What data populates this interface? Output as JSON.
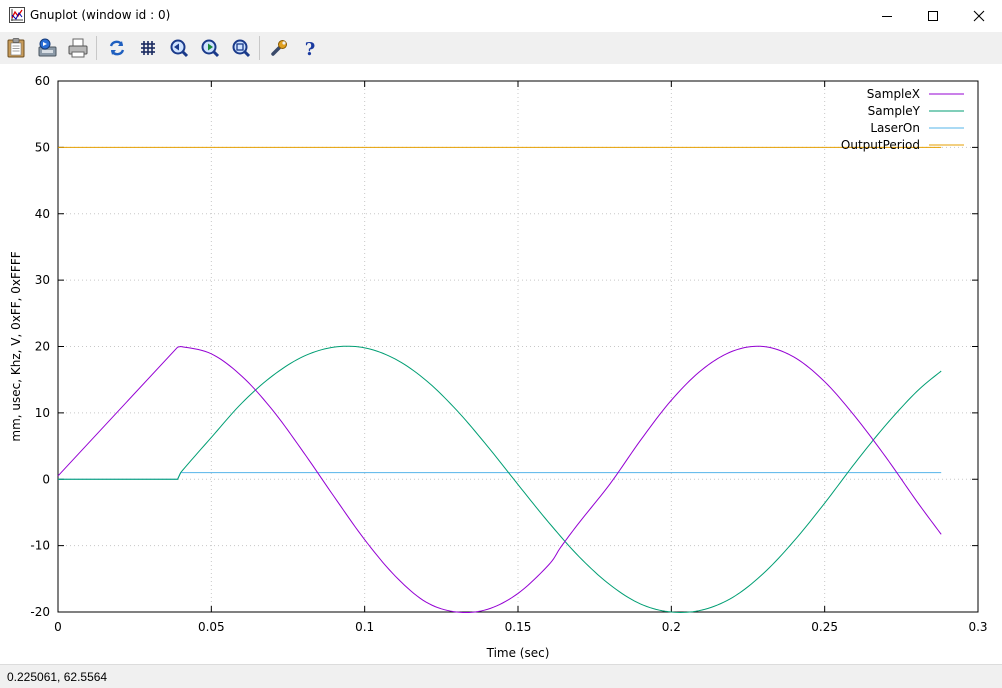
{
  "window": {
    "title": "Gnuplot (window id : 0)"
  },
  "toolbar": {
    "buttons": [
      {
        "name": "copy-clipboard",
        "icon": "clipboard-icon"
      },
      {
        "name": "print-export",
        "icon": "export-icon"
      },
      {
        "name": "print",
        "icon": "printer-icon"
      },
      {
        "name": "replot",
        "icon": "refresh-icon"
      },
      {
        "name": "toggle-grid",
        "icon": "grid-icon"
      },
      {
        "name": "zoom-back",
        "icon": "zoom-back-icon"
      },
      {
        "name": "zoom-forward",
        "icon": "zoom-forward-icon"
      },
      {
        "name": "autoscale",
        "icon": "zoom-fit-icon"
      },
      {
        "name": "options",
        "icon": "wrench-icon"
      },
      {
        "name": "help",
        "icon": "help-icon"
      }
    ]
  },
  "statusbar": {
    "coords": "0.225061,  62.5564"
  },
  "chart_data": {
    "type": "line",
    "title": "",
    "xlabel": "Time (sec)",
    "ylabel": "mm, usec, Khz, V, 0xFF, 0xFFFF",
    "xlim": [
      0,
      0.3
    ],
    "ylim": [
      -20,
      60
    ],
    "xticks": [
      "0",
      "0.05",
      "0.1",
      "0.15",
      "0.2",
      "0.25",
      "0.3"
    ],
    "yticks": [
      "-20",
      "-10",
      "0",
      "10",
      "20",
      "30",
      "40",
      "50",
      "60"
    ],
    "grid": true,
    "legend_position": "top-right",
    "series": [
      {
        "name": "SampleX",
        "color": "#9400d3",
        "x": [
          0,
          0.039,
          0.04,
          0.05,
          0.06,
          0.07,
          0.08,
          0.09,
          0.1,
          0.11,
          0.12,
          0.13,
          0.14,
          0.15,
          0.16,
          0.164,
          0.17,
          0.18,
          0.19,
          0.2,
          0.21,
          0.22,
          0.23,
          0.24,
          0.25,
          0.26,
          0.27,
          0.28,
          0.288
        ],
        "y": [
          0.5,
          19.9,
          20,
          18.9,
          15.5,
          10.4,
          4.1,
          -2.6,
          -9.1,
          -14.6,
          -18.5,
          -20,
          -19.6,
          -17.2,
          -12.9,
          -10.2,
          -6.5,
          -0.7,
          5.9,
          11.9,
          16.5,
          19.3,
          20,
          18.4,
          14.7,
          9.4,
          3.3,
          -3.3,
          -8.3
        ]
      },
      {
        "name": "SampleY",
        "color": "#009e73",
        "x": [
          0,
          0.039,
          0.04,
          0.05,
          0.06,
          0.07,
          0.08,
          0.09,
          0.1,
          0.11,
          0.12,
          0.13,
          0.14,
          0.15,
          0.16,
          0.17,
          0.18,
          0.19,
          0.2,
          0.21,
          0.22,
          0.23,
          0.24,
          0.25,
          0.26,
          0.27,
          0.28,
          0.288
        ],
        "y": [
          0,
          0,
          1,
          6.3,
          11.5,
          15.6,
          18.5,
          19.9,
          19.8,
          18.1,
          14.9,
          10.4,
          5.0,
          -0.8,
          -6.5,
          -11.7,
          -15.9,
          -18.8,
          -20,
          -19.7,
          -17.8,
          -14.2,
          -9.3,
          -3.6,
          2.5,
          8.2,
          13.2,
          16.3
        ]
      },
      {
        "name": "LaserOn",
        "color": "#56b4e9",
        "x": [
          0,
          0.039,
          0.04,
          0.288
        ],
        "y": [
          0,
          0,
          1,
          1
        ]
      },
      {
        "name": "OutputPeriod",
        "color": "#e69f00",
        "x": [
          0,
          0.288
        ],
        "y": [
          50,
          50
        ]
      }
    ]
  }
}
